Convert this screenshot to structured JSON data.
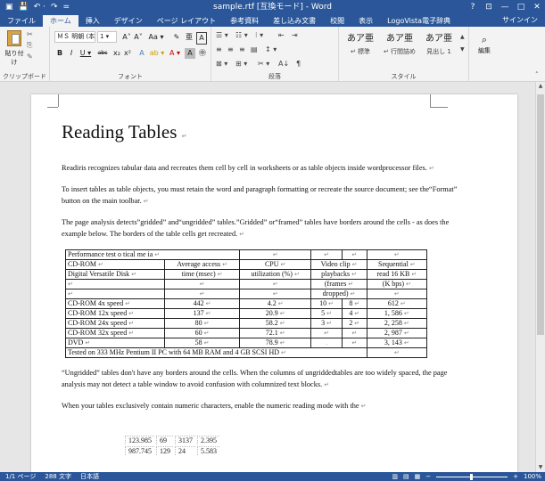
{
  "window": {
    "title": "sample.rtf [互換モード] - Word",
    "qat": [
      "▣",
      "💾",
      "↶ ·",
      "↷",
      "="
    ],
    "buttons": [
      "?",
      "⊡",
      "—",
      "□",
      "✕"
    ]
  },
  "tabs": {
    "file": "ファイル",
    "items": [
      "ホーム",
      "挿入",
      "デザイン",
      "ページ レイアウト",
      "参考資料",
      "差し込み文書",
      "校閲",
      "表示",
      "LogoVista電子辞典"
    ],
    "active": "ホーム",
    "signin": "サインイン"
  },
  "ribbon": {
    "clipboard": {
      "paste": "貼り付け",
      "label": "クリップボード"
    },
    "font": {
      "name": "ＭＳ 明朝 (本 ▾",
      "size": "1 ▾",
      "label": "フォント",
      "row1": [
        "A˄",
        "A˅",
        "Aa ▾",
        "✎",
        "亜",
        "A"
      ],
      "row2": [
        "B",
        "I",
        "U ▾",
        "abc",
        "x₂",
        "x²",
        "A",
        "ab ▾",
        "A ▾",
        "A",
        "㊥"
      ]
    },
    "paragraph": {
      "label": "段落",
      "row1": [
        "☰ ▾",
        "☷ ▾",
        "⁝ ▾",
        "⇤",
        "⇥"
      ],
      "row2": [
        "≡",
        "≡",
        "≡",
        "▤",
        "↕ ▾"
      ],
      "row3": [
        "⊠ ▾",
        "⊞ ▾",
        "✂ ▾",
        "A↓",
        "¶"
      ]
    },
    "styles": {
      "label": "スタイル",
      "items": [
        {
          "sample": "あア亜",
          "name": "↵ 標準"
        },
        {
          "sample": "あア亜",
          "name": "↵ 行間詰め"
        },
        {
          "sample": "あア亜",
          "name": "見出し 1"
        }
      ]
    },
    "editing": {
      "label": "編集"
    }
  },
  "document": {
    "title": "Reading Tables",
    "paragraphs": [
      "Readiris recognizes tabular data and recreates them cell by cell in worksheets or as table objects inside wordprocessor files.",
      "To insert tables as table objects,    you must retain the word and paragraph formatting or recreate the source document; see the“Format” button on the main toolbar.",
      "The page analysis detects”gridded” and“ungridded” tables.”Gridded” or“framed” tables have borders around the cells - as does the example below. The borders of the table cells get recreated."
    ],
    "table": {
      "caption": "Performance test o tical me ia",
      "header": [
        [
          "CD-ROM",
          "Average access",
          "CPU",
          "Video clip",
          "Sequential"
        ],
        [
          "Digital Versatile Disk",
          "time (msec)",
          "utilization (%)",
          "playbacks",
          "read 16 KB"
        ],
        [
          "",
          "",
          "",
          "(frames",
          "(K bps)"
        ],
        [
          "",
          "",
          "",
          "dropped)",
          ""
        ]
      ],
      "rows": [
        [
          "CD-ROM 4x speed",
          "442",
          "4.2",
          "10",
          "8",
          "612"
        ],
        [
          "CD-ROM 12x speed",
          "137",
          "20.9",
          "5",
          "4",
          "1, 586"
        ],
        [
          "CD-ROM 24x speed",
          "80",
          "58.2",
          "3",
          "2",
          "2, 258"
        ],
        [
          "CD-ROM 32x speed",
          "60",
          "72.1",
          "",
          "",
          "2, 987"
        ],
        [
          "DVD",
          "58",
          "78.9",
          "",
          "",
          "3, 143"
        ]
      ],
      "footer": "Tested on 333 MHz Pentium II PC with 64 MB RAM and 4 GB SCSI HD"
    },
    "after": [
      "“Ungridded” tables don't have any borders around the cells. When the columns of ungriddedtables are too widely spaced,   the page analysis may not detect a table window to avoid confusion with columnized text blocks.",
      "When your tables exclusively contain numeric characters,   enable the numeric reading mode with the"
    ],
    "numtable": [
      [
        "123.985",
        "69",
        "3137",
        "2.395"
      ],
      [
        "987.745",
        "129",
        "24",
        "5.583"
      ]
    ]
  },
  "status": {
    "page": "1/1 ページ",
    "words": "288 文字",
    "lang": "日本語",
    "zoom": "100%",
    "minus": "−",
    "plus": "+"
  }
}
